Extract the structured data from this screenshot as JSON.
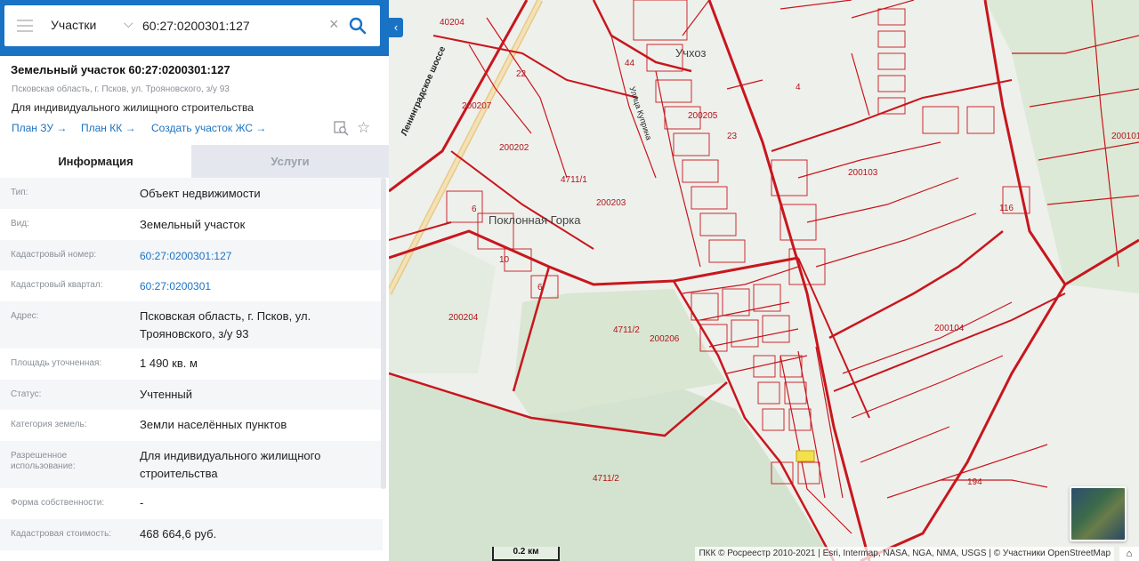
{
  "search": {
    "layer": "Участки",
    "query": "60:27:0200301:127"
  },
  "object": {
    "title": "Земельный участок 60:27:0200301:127",
    "address": "Псковская область, г. Псков, ул. Трояновского, з/у 93",
    "purpose": "Для индивидуального жилищного строительства"
  },
  "links": {
    "plan_zu": "План ЗУ →",
    "plan_kk": "План КК →",
    "create_zs": "Создать участок ЖС →"
  },
  "tabs": {
    "info": "Информация",
    "services": "Услуги"
  },
  "attributes": [
    {
      "label": "Тип:",
      "value": "Объект недвижимости"
    },
    {
      "label": "Вид:",
      "value": "Земельный участок"
    },
    {
      "label": "Кадастровый номер:",
      "value": "60:27:0200301:127"
    },
    {
      "label": "Кадастровый квартал:",
      "value": "60:27:0200301"
    },
    {
      "label": "Адрес:",
      "value": "Псковская область, г. Псков, ул. Трояновского, з/у 93"
    },
    {
      "label": "Площадь уточненная:",
      "value": "1 490 кв. м"
    },
    {
      "label": "Статус:",
      "value": "Учтенный"
    },
    {
      "label": "Категория земель:",
      "value": "Земли населённых пунктов"
    },
    {
      "label": "Разрешенное использование:",
      "value": "Для индивидуального жилищного строительства"
    },
    {
      "label": "Форма собственности:",
      "value": "-"
    },
    {
      "label": "Кадастровая стоимость:",
      "value": "468 664,6 руб."
    }
  ],
  "map": {
    "labels": {
      "l40204": "40204",
      "l200207": "200207",
      "l200202": "200202",
      "l47111": "4711/1",
      "l200203": "200203",
      "l200204": "200204",
      "l47112a": "4711/2",
      "l200206": "200206",
      "l47112b": "4711/2",
      "l200205": "200205",
      "l4": "4",
      "l200103": "200103",
      "l200104": "200104",
      "l200101": "200101",
      "l194": "194",
      "l22": "22",
      "l44": "44",
      "l23": "23",
      "l116": "116",
      "l6a": "6",
      "l6b": "6",
      "l10": "10"
    },
    "places": {
      "poklonnaya": "Поклонная Горка",
      "uchkhoz": "Учхоз"
    },
    "roads": {
      "leningradskoe": "Ленинградское шоссе",
      "kuprina": "Улица Куприна"
    },
    "scale": "0.2 км",
    "attribution": "ПКК © Росреестр 2010-2021 | Esri, Intermap, NASA, NGA, NMA, USGS | © Участники OpenStreetMap"
  },
  "colors": {
    "brand": "#1a72c4",
    "parcel": "#c8161d",
    "selected_parcel": "#f4e04d"
  }
}
